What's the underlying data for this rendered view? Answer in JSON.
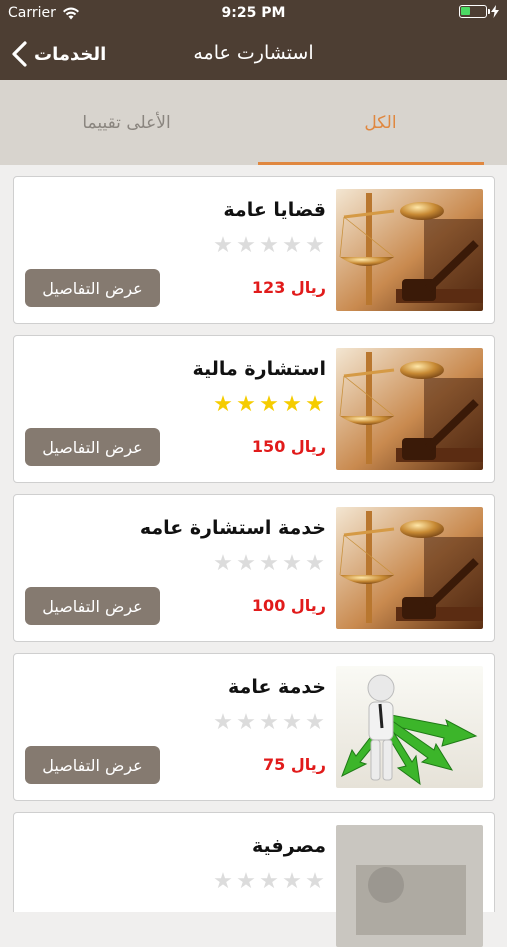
{
  "status": {
    "carrier": "Carrier",
    "time": "9:25 PM"
  },
  "nav": {
    "back_label": "الخدمات",
    "title": "استشارت عامه"
  },
  "tabs": [
    {
      "label": "الأعلى تقييما",
      "active": false
    },
    {
      "label": "الكل",
      "active": true
    }
  ],
  "colors": {
    "header": "#4d3e33",
    "accent": "#e0873f",
    "price": "#e11b1b",
    "button": "#857a70",
    "star": "#f5cc00"
  },
  "services": [
    {
      "title": "قضايا عامة",
      "rating": 0,
      "price": "123 ريال",
      "button": "عرض التفاصيل",
      "image": "scales-gavel"
    },
    {
      "title": "استشارة مالية",
      "rating": 5,
      "price": "150 ريال",
      "button": "عرض التفاصيل",
      "image": "scales-gavel"
    },
    {
      "title": "خدمة استشارة عامه",
      "rating": 0,
      "price": "100 ريال",
      "button": "عرض التفاصيل",
      "image": "scales-gavel"
    },
    {
      "title": "خدمة عامة",
      "rating": 0,
      "price": "75 ريال",
      "button": "عرض التفاصيل",
      "image": "figure-arrows"
    },
    {
      "title": "مصرفية",
      "rating": 0,
      "image": "blurred-photo"
    }
  ]
}
